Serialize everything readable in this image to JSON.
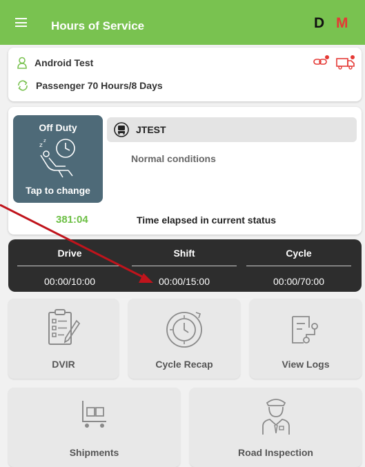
{
  "app_bar": {
    "title": "Hours of Service",
    "badge_d": "D",
    "badge_m": "M",
    "bg": "#79c250"
  },
  "user": {
    "name": "Android Test",
    "ruleset": "Passenger 70 Hours/8 Days"
  },
  "status": {
    "duty_title": "Off Duty",
    "duty_action": "Tap to change",
    "vehicle": "JTEST",
    "conditions": "Normal conditions",
    "elapsed": "381:04",
    "elapsed_label": "Time elapsed in current status"
  },
  "timers": [
    {
      "label": "Drive",
      "value": "00:00/10:00"
    },
    {
      "label": "Shift",
      "value": "00:00/15:00"
    },
    {
      "label": "Cycle",
      "value": "00:00/70:00"
    }
  ],
  "tiles": [
    {
      "label": "DVIR",
      "icon": "clipboard-icon"
    },
    {
      "label": "Cycle Recap",
      "icon": "stopwatch-icon"
    },
    {
      "label": "View Logs",
      "icon": "logs-icon"
    },
    {
      "label": "Shipments",
      "icon": "cart-icon"
    },
    {
      "label": "Road Inspection",
      "icon": "officer-icon"
    }
  ],
  "colors": {
    "accent_green": "#6cbf44",
    "alert_red": "#e53935",
    "duty_tile": "#4e6a78",
    "annotation_arrow": "#c0141c"
  }
}
